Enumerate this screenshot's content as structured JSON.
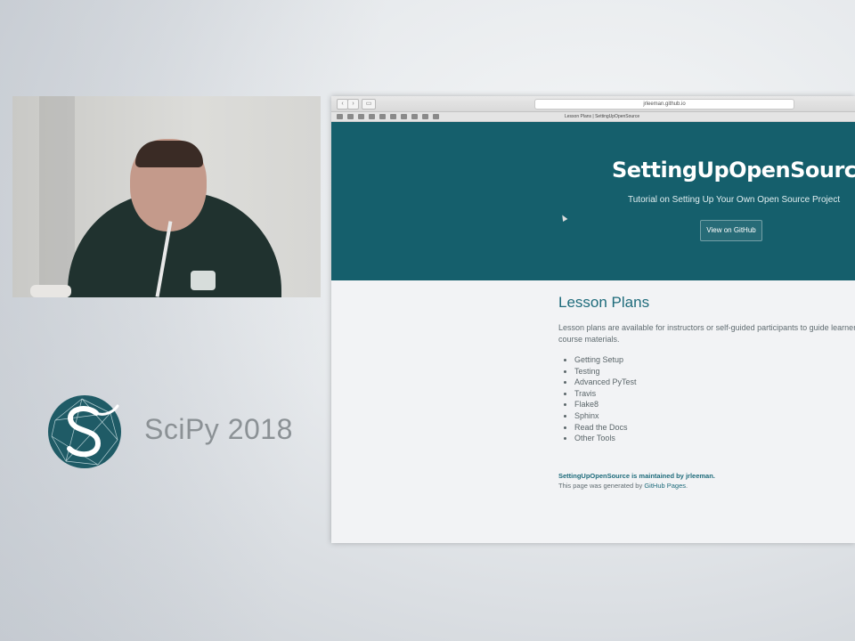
{
  "branding": {
    "conference": "SciPy 2018",
    "logo_icon": "scipy-snake-logo-icon",
    "logo_color": "#1f5b66"
  },
  "browser": {
    "url": "jrleeman.github.io",
    "tab_title": "Lesson Plans | SettingUpOpenSource",
    "back_icon": "chevron-left-icon",
    "forward_icon": "chevron-right-icon",
    "sidebar_icon": "sidebar-icon"
  },
  "hero": {
    "title": "SettingUpOpenSource",
    "subtitle": "Tutorial on Setting Up Your Own Open Source Project",
    "button_label": "View on GitHub",
    "bg_color": "#155f6c"
  },
  "content": {
    "heading": "Lesson Plans",
    "paragraph": "Lesson plans are available for instructors or self-guided participants to guide learners course materials.",
    "lessons": [
      "Getting Setup",
      "Testing",
      "Advanced PyTest",
      "Travis",
      "Flake8",
      "Sphinx",
      "Read the Docs",
      "Other Tools"
    ]
  },
  "footer": {
    "maintained": "SettingUpOpenSource is maintained by jrleeman.",
    "generated_prefix": "This page was generated by ",
    "generated_link": "GitHub Pages",
    "generated_suffix": "."
  }
}
